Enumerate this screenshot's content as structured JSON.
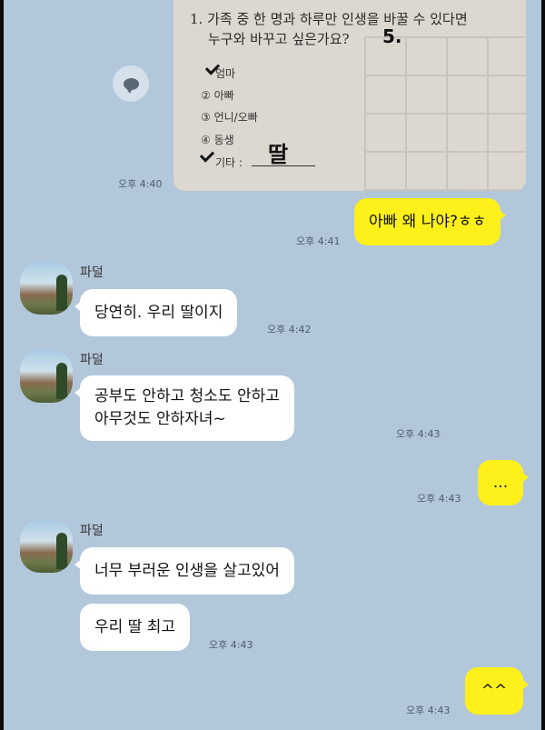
{
  "photo": {
    "question_line1": "1. 가족 중 한 명과 하루만 인생을 바꿀 수 있다면",
    "question_line2": "누구와 바꾸고 싶은가요?",
    "handwritten_mark": "5.",
    "options": [
      "엄마",
      "② 아빠",
      "③ 언니/오빠",
      "④ 동생",
      "기타 :"
    ],
    "handwritten_answer": "딸"
  },
  "messages": [
    {
      "time": "오후 4:40"
    },
    {
      "text": "아빠 왜 나야?ㅎㅎ",
      "time": "오후 4:41"
    },
    {
      "sender": "파덜",
      "text": "당연히. 우리 딸이지",
      "time": "오후 4:42"
    },
    {
      "sender": "파덜",
      "line1": "공부도 안하고 청소도 안하고",
      "line2": "아무것도 안하자녀~",
      "time": "오후 4:43"
    },
    {
      "text": "...",
      "time": "오후 4:43"
    },
    {
      "sender": "파덜",
      "text": "너무 부러운 인생을 살고있어",
      "text2": "우리 딸 최고",
      "time": "오후 4:43"
    },
    {
      "text": "^^",
      "time": "오후 4:43"
    }
  ],
  "colors": {
    "chat_background": "#b2c7da",
    "my_bubble": "#fef01b",
    "other_bubble": "#ffffff"
  },
  "icons": {
    "share": "speech-bubble-icon",
    "check": "checkmark-icon"
  }
}
